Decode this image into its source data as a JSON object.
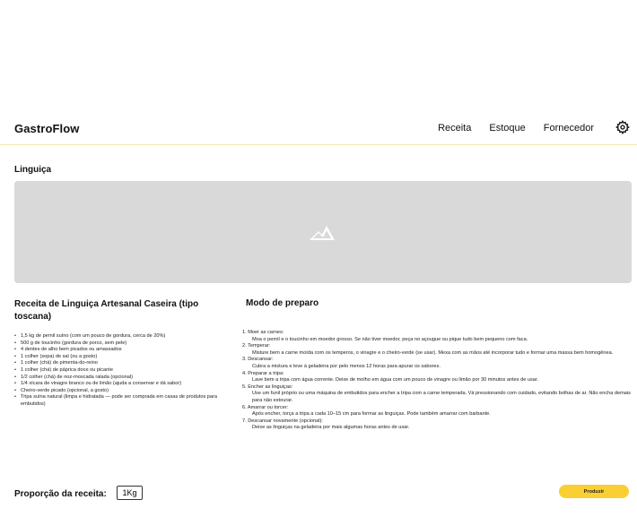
{
  "header": {
    "brand": "GastroFlow",
    "nav": [
      "Receita",
      "Estoque",
      "Fornecedor"
    ],
    "settings_icon": "gear-icon"
  },
  "page": {
    "title": "Linguiça",
    "image_placeholder_icon": "image-placeholder-icon"
  },
  "recipe": {
    "title": "Receita de Linguiça Artesanal Caseira (tipo toscana)",
    "ingredients": [
      "1,5 kg de pernil suíno (com um pouco de gordura, cerca de 20%)",
      "500 g de toucinho (gordura de porco, sem pele)",
      "4 dentes de alho bem picados ou amassados",
      "1 colher (sopa) de sal (ou a gosto)",
      "1 colher (chá) de pimenta-do-reino",
      "1 colher (chá) de páprica doce ou picante",
      "1/2 colher (chá) de noz-moscada ralada (opcional)",
      "1/4 xícara de vinagre branco ou de limão (ajuda a conservar e dá sabor)",
      "Cheiro-verde picado (opcional, a gosto)",
      "Tripa suína natural (limpa e hidratada — pode ser comprada em casas de produtos para embutidos)"
    ]
  },
  "method": {
    "title": "Modo de preparo",
    "steps": [
      {
        "title": "1. Moer as carnes:",
        "text": "Moa o pernil e o toucinho em moedor grosso. Se não tiver moedor, peça no açougue ou pique tudo bem pequeno com faca."
      },
      {
        "title": "2. Temperar:",
        "text": "Misture bem a carne moída com os temperos, o vinagre e o cheiro-verde (se usar). Mexa com as mãos até incorporar tudo e formar uma massa bem homogênea."
      },
      {
        "title": "3. Descansar:",
        "text": "Cubra a mistura e leve à geladeira por pelo menos 12 horas para apurar os sabores."
      },
      {
        "title": "4. Preparar a tripa:",
        "text": "Lave bem a tripa com água corrente. Deixe de molho em água com um pouco de vinagre ou limão por 30 minutos antes de usar."
      },
      {
        "title": "5. Encher as linguiças:",
        "text": "Use um funil próprio ou uma máquina de embutidos para encher a tripa com a carne temperada. Vá pressionando com cuidado, evitando bolhas de ar. Não encha demais para não estourar."
      },
      {
        "title": "6. Amarrar ou torcer:",
        "text": "Após encher, torça a tripa a cada 10–15 cm para formar as linguiças. Pode também amarrar com barbante."
      },
      {
        "title": "7. Descansar novamente (opcional):",
        "text": "Deixe as linguiças na geladeira por mais algumas horas antes de usar."
      }
    ]
  },
  "footer": {
    "proportion_label": "Proporção da receita:",
    "proportion_value": "1Kg",
    "produce_label": "Produzir"
  }
}
